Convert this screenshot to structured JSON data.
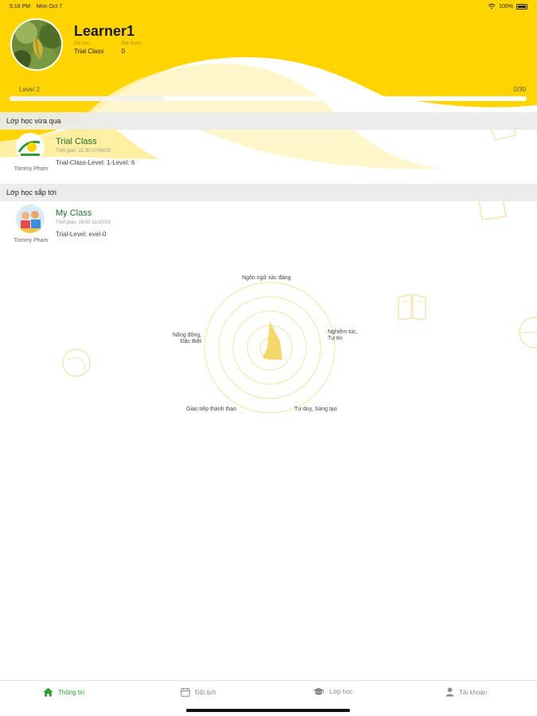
{
  "status_bar": {
    "time": "5:16 PM",
    "date": "Mon Oct 7",
    "wifi_icon": "wifi-icon",
    "battery_percent": "100%"
  },
  "profile": {
    "name": "Learner1",
    "col1_label": "Đã học",
    "col1_value": "Trial Class",
    "col2_label": "Đạt được",
    "col2_value": "0",
    "avatar_icon": "leaf-photo"
  },
  "level": {
    "label": "Level 2",
    "progress_text": "0/30",
    "fill_fraction": 0.3
  },
  "recent": {
    "header": "Lớp học vừa qua",
    "class_name": "Trial Class",
    "time": "Thời gian: 21:30 07/08/19",
    "level": "Trial-Class-Level: 1-Level: 6",
    "teacher": "Tommy Pham"
  },
  "upcoming": {
    "header": "Lớp học sắp tới",
    "class_name": "My Class",
    "time": "Thời gian: 19:00 31/10/19",
    "level": "Trial-Level: evel-0",
    "teacher": "Tommy Pham"
  },
  "radar": {
    "labels": {
      "top": "Ngôn ngữ xác đáng",
      "right_line1": "Nghiêm túc,",
      "right_line2": "Tự tin",
      "left_line1": "Năng động,",
      "left_line2": "Đặc Biệt",
      "bottom_left": "Giao tiếp thành thạo",
      "bottom_right": "Tư duy, Sáng tạo"
    },
    "accent_color": "#f5d35a"
  },
  "tabs": [
    {
      "label": "Thông tin",
      "icon": "home-icon",
      "active": true
    },
    {
      "label": "Đặt lịch",
      "icon": "calendar-icon",
      "active": false
    },
    {
      "label": "Lớp học",
      "icon": "graduation-cap-icon",
      "active": false
    },
    {
      "label": "Tài khoản",
      "icon": "user-icon",
      "active": false
    }
  ],
  "colors": {
    "brand_yellow": "#ffd400",
    "active_tab": "#2e9e2e",
    "class_title": "#1b6e2f"
  }
}
